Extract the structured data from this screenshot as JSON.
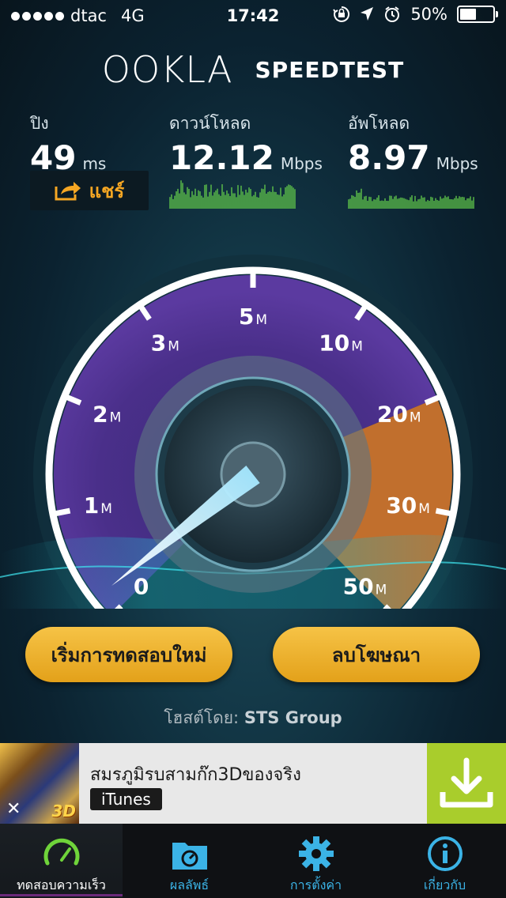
{
  "status_bar": {
    "carrier": "dtac",
    "network": "4G",
    "time": "17:42",
    "battery": "50%",
    "battery_level": 0.5
  },
  "header": {
    "logo": "OOKLA",
    "title": "SPEEDTEST"
  },
  "results": {
    "ping": {
      "label": "ปิง",
      "value": "49",
      "unit": "ms"
    },
    "download": {
      "label": "ดาวน์โหลด",
      "value": "12.12",
      "unit": "Mbps"
    },
    "upload": {
      "label": "อัพโหลด",
      "value": "8.97",
      "unit": "Mbps"
    },
    "share_label": "แชร์"
  },
  "gauge": {
    "ticks": [
      {
        "n": "0",
        "u": ""
      },
      {
        "n": "1",
        "u": "M"
      },
      {
        "n": "2",
        "u": "M"
      },
      {
        "n": "3",
        "u": "M"
      },
      {
        "n": "5",
        "u": "M"
      },
      {
        "n": "10",
        "u": "M"
      },
      {
        "n": "20",
        "u": "M"
      },
      {
        "n": "30",
        "u": "M"
      },
      {
        "n": "50",
        "u": "M"
      }
    ],
    "needle_value": 0.2
  },
  "buttons": {
    "restart": "เริ่มการทดสอบใหม่",
    "remove_ads": "ลบโฆษณา"
  },
  "host": {
    "label": "โฮสต์โดย:",
    "name": "STS Group"
  },
  "ad": {
    "title": "สมรภูมิรบสามก๊ก3Dของจริง",
    "badge": "iTunes",
    "image_text": "3D"
  },
  "tabs": [
    {
      "label": "ทดสอบความเร็ว",
      "icon": "speedometer-icon",
      "active": true
    },
    {
      "label": "ผลลัพธ์",
      "icon": "results-folder-icon"
    },
    {
      "label": "การตั้งค่า",
      "icon": "gear-icon"
    },
    {
      "label": "เกี่ยวกับ",
      "icon": "info-icon"
    }
  ],
  "colors": {
    "accent": "#f5a623",
    "graph": "#5ec34a",
    "tab": "#3bb3e6",
    "ad_download": "#a9cd2c"
  }
}
